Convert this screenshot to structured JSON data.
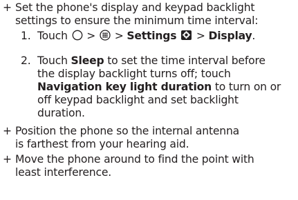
{
  "bullet_symbol": "+",
  "items": [
    {
      "lines": [
        "Set the phone's display and keypad backlight",
        "settings to ensure the minimum time interval:"
      ],
      "steps": [
        {
          "number": "1.",
          "prefix": "Touch",
          "sep1": ">",
          "sep2": ">",
          "settings_label": "Settings",
          "sep3": ">",
          "display_label": "Display",
          "end": ".",
          "icons": [
            "home-circle-icon",
            "apps-icon",
            "settings-gear-icon"
          ]
        },
        {
          "number": "2.",
          "line1_prefix": "Touch",
          "line1_bold": "Sleep",
          "line1_rest": "to set the time interval before",
          "line2": "the display backlight turns off; touch",
          "line3_bold": "Navigation key light duration",
          "line3_rest": "to turn on or",
          "line4": "off keypad backlight and set backlight",
          "line5": "duration."
        }
      ]
    },
    {
      "lines": [
        "Position the phone so the internal antenna",
        "is farthest from your hearing aid."
      ]
    },
    {
      "lines": [
        "Move the phone around to find the point with",
        "least interference."
      ]
    }
  ]
}
